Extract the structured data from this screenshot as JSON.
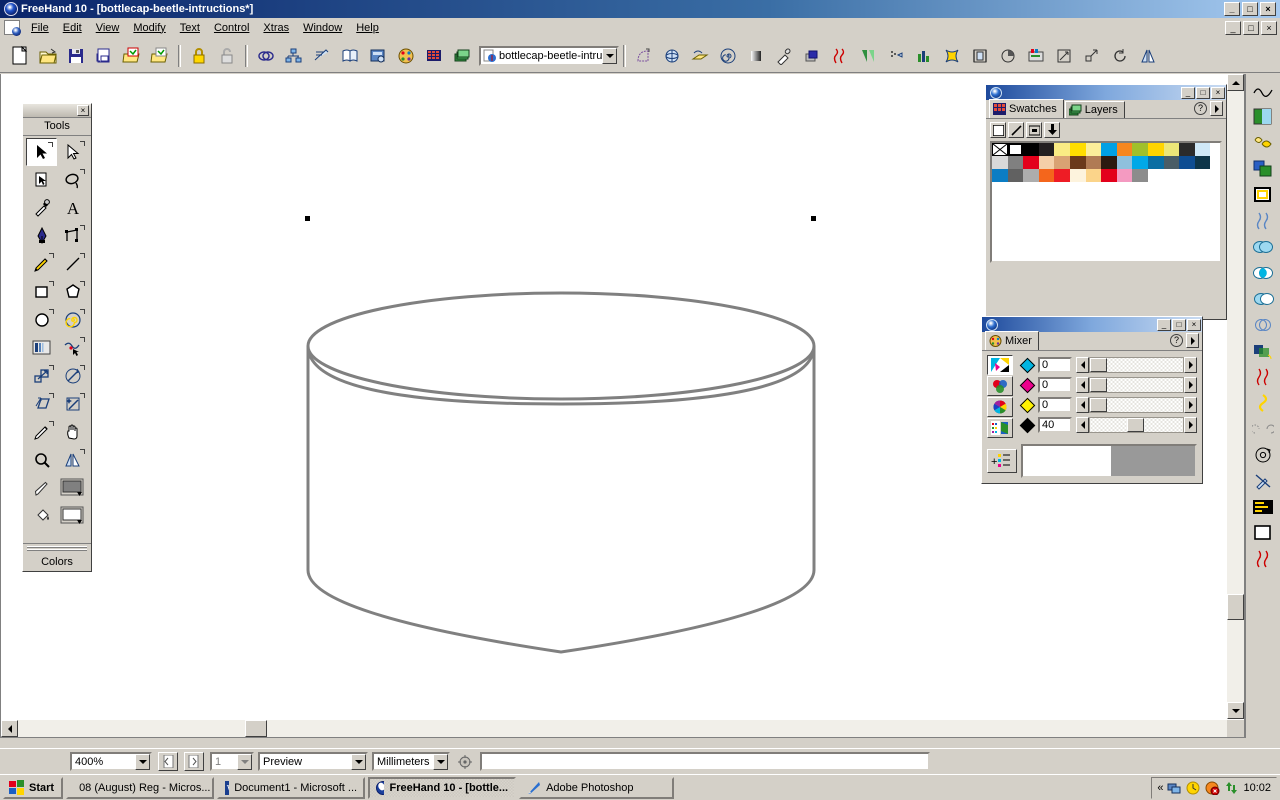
{
  "window": {
    "title": "FreeHand 10 - [bottlecap-beetle-intructions*]",
    "app_icon": "freehand-logo-icon",
    "minimize": "_",
    "maximize": "□",
    "close": "×"
  },
  "menubar": {
    "items": [
      {
        "label": "File",
        "accel": "F"
      },
      {
        "label": "Edit",
        "accel": "E"
      },
      {
        "label": "View",
        "accel": "V"
      },
      {
        "label": "Modify",
        "accel": "M"
      },
      {
        "label": "Text",
        "accel": "T"
      },
      {
        "label": "Control",
        "accel": "C"
      },
      {
        "label": "Xtras",
        "accel": "X"
      },
      {
        "label": "Window",
        "accel": "W"
      },
      {
        "label": "Help",
        "accel": "H"
      }
    ]
  },
  "main_toolbar": {
    "buttons": [
      {
        "name": "new-document",
        "icon": "page-icon"
      },
      {
        "name": "open-document",
        "icon": "open-folder-icon"
      },
      {
        "name": "save-document",
        "icon": "floppy-disk-icon"
      },
      {
        "name": "print",
        "icon": "printer-icon"
      },
      {
        "name": "import",
        "icon": "import-arrow-icon"
      },
      {
        "name": "export",
        "icon": "export-arrow-icon"
      },
      {
        "name": "lock",
        "icon": "padlock-closed-icon"
      },
      {
        "name": "unlock",
        "icon": "padlock-open-icon"
      },
      {
        "name": "group",
        "icon": "group-icon"
      },
      {
        "name": "ungroup",
        "icon": "ungroup-icon"
      },
      {
        "name": "join",
        "icon": "join-icon"
      },
      {
        "name": "library",
        "icon": "book-icon"
      },
      {
        "name": "object-inspector",
        "icon": "inspector-icon"
      },
      {
        "name": "color-mixer",
        "icon": "palette-icon"
      },
      {
        "name": "swatches",
        "icon": "grid-swatch-icon"
      },
      {
        "name": "layers",
        "icon": "layers-icon"
      }
    ],
    "document_combo": {
      "value": "bottlecap-beetle-intructi",
      "arrow": "chevron-down-icon"
    }
  },
  "xtras_toolbar": {
    "buttons": [
      {
        "name": "trace",
        "icon": "corner-shape-icon"
      },
      {
        "name": "3d-rotate",
        "icon": "globe-rotate-icon"
      },
      {
        "name": "extrude",
        "icon": "extrude-icon"
      },
      {
        "name": "spiral",
        "icon": "spiral-icon"
      },
      {
        "name": "shadow",
        "icon": "shadow-block-icon"
      },
      {
        "name": "eyedropper-xtra",
        "icon": "eyedropper-icon"
      },
      {
        "name": "emboss",
        "icon": "emboss-square-icon"
      },
      {
        "name": "roughen",
        "icon": "roughen-icon"
      },
      {
        "name": "blend-fill",
        "icon": "gradient-triangle-icon"
      },
      {
        "name": "trap",
        "icon": "dots-arrow-icon"
      },
      {
        "name": "chart",
        "icon": "bar-chart-icon"
      },
      {
        "name": "envelope",
        "icon": "envelope-star-icon"
      },
      {
        "name": "align",
        "icon": "align-icon"
      },
      {
        "name": "arc",
        "icon": "arc-circle-icon"
      },
      {
        "name": "graphic-hose",
        "icon": "graphic-hose-icon"
      },
      {
        "name": "scale",
        "icon": "scale-arrow-icon"
      },
      {
        "name": "expand-stroke",
        "icon": "expand-arrow-icon"
      },
      {
        "name": "rotate",
        "icon": "rotate-circle-icon"
      },
      {
        "name": "mirror",
        "icon": "mirror-icon"
      }
    ]
  },
  "tools_panel": {
    "close": "×",
    "title": "Tools",
    "footer": "Colors",
    "tools": [
      {
        "name": "pointer-tool",
        "icon": "arrow-pointer-icon",
        "selected": true
      },
      {
        "name": "subselect-tool",
        "icon": "hollow-arrow-icon",
        "selected": false
      },
      {
        "name": "page-tool",
        "icon": "page-select-icon",
        "selected": false
      },
      {
        "name": "lasso-tool",
        "icon": "lasso-icon",
        "selected": false
      },
      {
        "name": "eyedropper-tool",
        "icon": "eyedropper-icon",
        "selected": false
      },
      {
        "name": "text-tool",
        "icon": "text-a-icon",
        "selected": false
      },
      {
        "name": "pen-tool",
        "icon": "pen-nib-icon",
        "selected": false
      },
      {
        "name": "bezigon-tool",
        "icon": "bezigon-icon",
        "selected": false
      },
      {
        "name": "pencil-tool",
        "icon": "pencil-icon",
        "selected": false
      },
      {
        "name": "line-tool",
        "icon": "line-icon",
        "selected": false
      },
      {
        "name": "rectangle-tool",
        "icon": "rectangle-icon",
        "selected": false
      },
      {
        "name": "polygon-tool",
        "icon": "polygon-icon",
        "selected": false
      },
      {
        "name": "ellipse-tool",
        "icon": "ellipse-icon",
        "selected": false
      },
      {
        "name": "spiral-tool",
        "icon": "spiral-icon",
        "selected": false
      },
      {
        "name": "blend-tool",
        "icon": "blend-icon",
        "selected": false
      },
      {
        "name": "freeform-tool",
        "icon": "freeform-icon",
        "selected": false
      },
      {
        "name": "scale-tool",
        "icon": "scale-icon",
        "selected": false
      },
      {
        "name": "rotate-tool",
        "icon": "rotate-icon",
        "selected": false
      },
      {
        "name": "skew-tool",
        "icon": "skew-icon",
        "selected": false
      },
      {
        "name": "trace-tool",
        "icon": "trace-wand-icon",
        "selected": false
      },
      {
        "name": "knife-tool",
        "icon": "knife-icon",
        "selected": false
      },
      {
        "name": "hand-tool",
        "icon": "hand-icon",
        "selected": false
      },
      {
        "name": "zoom-tool",
        "icon": "magnifier-icon",
        "selected": false
      },
      {
        "name": "mirror-tool",
        "icon": "mirror-icon",
        "selected": false
      },
      {
        "name": "stroke-tool",
        "icon": "stroke-pen-icon",
        "selected": false
      },
      {
        "name": "stroke-color-well",
        "icon": "color-well-icon",
        "selected": false
      },
      {
        "name": "fill-tool",
        "icon": "paint-bucket-icon",
        "selected": false
      },
      {
        "name": "fill-color-well",
        "icon": "color-well-icon",
        "selected": false
      }
    ]
  },
  "swatches_panel": {
    "titlebar_icon": "freehand-logo-icon",
    "buttons": {
      "minimize": "_",
      "maximize": "□",
      "close": "×"
    },
    "tabs": [
      {
        "label": "Swatches",
        "icon": "swatch-grid-icon",
        "active": true
      },
      {
        "label": "Layers",
        "icon": "layers-stack-icon",
        "active": false
      }
    ],
    "help_glyph": "?",
    "options_glyph": "▶",
    "apply_buttons": [
      {
        "name": "apply-fill-button",
        "icon": "fill-square-icon"
      },
      {
        "name": "apply-stroke-button",
        "icon": "stroke-line-icon"
      },
      {
        "name": "apply-both-button",
        "icon": "both-icon"
      },
      {
        "name": "add-swatch-button",
        "icon": "down-arrow-icon"
      }
    ],
    "swatch_rows": [
      [
        "none",
        "#ffffff",
        "#000000",
        "#231f20",
        "#faeb84",
        "#ffdd00",
        "#fbee9a",
        "#00a0e3",
        "#f6871f",
        "#a0c02b",
        "#ffd400",
        "#ece678",
        "#2b2b2b",
        "#cfe8f7",
        "#ffffff"
      ],
      [
        "#d9d9d9",
        "#808080",
        "#e3001b",
        "#f4cfa8",
        "#d9a273",
        "#6b3a1b",
        "#b07b54",
        "#2b1a10",
        "#8fc0dd",
        "#00a8e8",
        "#0b6ea3",
        "#4a5d66",
        "#0e4d92",
        "#0d3549",
        "#ffffff"
      ],
      [
        "#0b7dc4",
        "#616161",
        "#adadad",
        "#f4661c",
        "#ee1c25",
        "#fdf3dd",
        "#fbd48a",
        "#e3001b",
        "#f49ac1",
        "#8c8c8c",
        "#ffffff",
        "#ffffff",
        "#ffffff",
        "#ffffff",
        "#ffffff"
      ]
    ]
  },
  "mixer_panel": {
    "titlebar_icon": "freehand-logo-icon",
    "buttons": {
      "minimize": "_",
      "maximize": "□",
      "close": "×"
    },
    "tab": {
      "label": "Mixer",
      "icon": "palette-icon"
    },
    "help_glyph": "?",
    "options_glyph": "▶",
    "modes": [
      {
        "name": "cmyk-mode-button",
        "icon": "cmyk-icon",
        "selected": true
      },
      {
        "name": "rgb-mode-button",
        "icon": "rgb-circles-icon",
        "selected": false
      },
      {
        "name": "hls-mode-button",
        "icon": "color-wheel-icon",
        "selected": false
      },
      {
        "name": "system-color-mode-button",
        "icon": "system-color-icon",
        "selected": false
      }
    ],
    "add-to-swatches": {
      "name": "add-to-swatches-button",
      "icon": "add-list-icon"
    },
    "channels": [
      {
        "name": "cyan",
        "value": "0",
        "chip": "#00b5e2",
        "percent": 0
      },
      {
        "name": "magenta",
        "value": "0",
        "chip": "#ec008c",
        "percent": 0
      },
      {
        "name": "yellow",
        "value": "0",
        "chip": "#fff200",
        "percent": 0
      },
      {
        "name": "black",
        "value": "40",
        "chip": "#000000",
        "percent": 40
      }
    ],
    "preview": {
      "new_color": "#ffffff",
      "current_color": "#999999"
    }
  },
  "right_toolbar": {
    "buttons": [
      {
        "name": "smooth-path",
        "icon": "wave-path-icon"
      },
      {
        "name": "fill-gradient",
        "icon": "gradient-square-icon"
      },
      {
        "name": "blend-shapes",
        "icon": "two-shapes-icon"
      },
      {
        "name": "duplicate-shape",
        "icon": "green-squares-icon"
      },
      {
        "name": "inset-path",
        "icon": "nested-square-icon"
      },
      {
        "name": "roughen-path",
        "icon": "roughen-squiggle-icon"
      },
      {
        "name": "union-paths",
        "icon": "union-circles-icon"
      },
      {
        "name": "intersect-paths",
        "icon": "intersect-circles-icon"
      },
      {
        "name": "punch-paths",
        "icon": "punch-circles-icon"
      },
      {
        "name": "divide-paths",
        "icon": "divide-circles-icon"
      },
      {
        "name": "transparency",
        "icon": "transparency-icon"
      },
      {
        "name": "squiggle-red",
        "icon": "red-squiggle-icon"
      },
      {
        "name": "fisheye-lens",
        "icon": "fisheye-icon"
      },
      {
        "name": "arc-tool",
        "icon": "arc-dotted-icon"
      },
      {
        "name": "spiral-xtra",
        "icon": "spiral-arrow-icon"
      },
      {
        "name": "eyedropper-off",
        "icon": "eyedropper-slash-icon"
      },
      {
        "name": "chart-xtra",
        "icon": "yellow-chart-icon"
      },
      {
        "name": "white-square",
        "icon": "white-square-icon"
      },
      {
        "name": "squiggle-red-2",
        "icon": "red-squiggle-icon"
      }
    ]
  },
  "canvas": {
    "artwork": {
      "name": "cylinder-shape",
      "stroke_color": "#808080",
      "fill_color": "#ffffff",
      "selection_handles": 2
    }
  },
  "statusbar": {
    "zoom": {
      "value": "400%",
      "arrow": "chevron-down-icon"
    },
    "prev_page": {
      "name": "previous-page-button",
      "icon": "page-left-icon"
    },
    "next_page": {
      "name": "next-page-button",
      "icon": "page-right-icon"
    },
    "page_number": {
      "value": "1",
      "arrow": "chevron-down-icon"
    },
    "view_mode": {
      "value": "Preview",
      "arrow": "chevron-down-icon"
    },
    "units": {
      "value": "Millimeters",
      "arrow": "chevron-down-icon"
    },
    "snap_icon": {
      "name": "snap-to-point-button",
      "icon": "snap-icon"
    },
    "message": ""
  },
  "taskbar": {
    "start": {
      "label": "Start",
      "icon": "windows-flag-icon"
    },
    "items": [
      {
        "label": "08 (August) Reg - Micros...",
        "icon": "outlook-icon",
        "active": false
      },
      {
        "label": "Document1 - Microsoft ...",
        "icon": "word-icon",
        "active": false
      },
      {
        "label": "FreeHand 10 - [bottle...",
        "icon": "freehand-logo-icon",
        "active": true
      },
      {
        "label": "Adobe Photoshop",
        "icon": "photoshop-icon",
        "active": false
      }
    ],
    "tray": {
      "expand": "«",
      "icons": [
        "network-icon",
        "outlook-tray-icon",
        "antivirus-icon",
        "updates-icon"
      ],
      "clock": "10:02"
    }
  }
}
